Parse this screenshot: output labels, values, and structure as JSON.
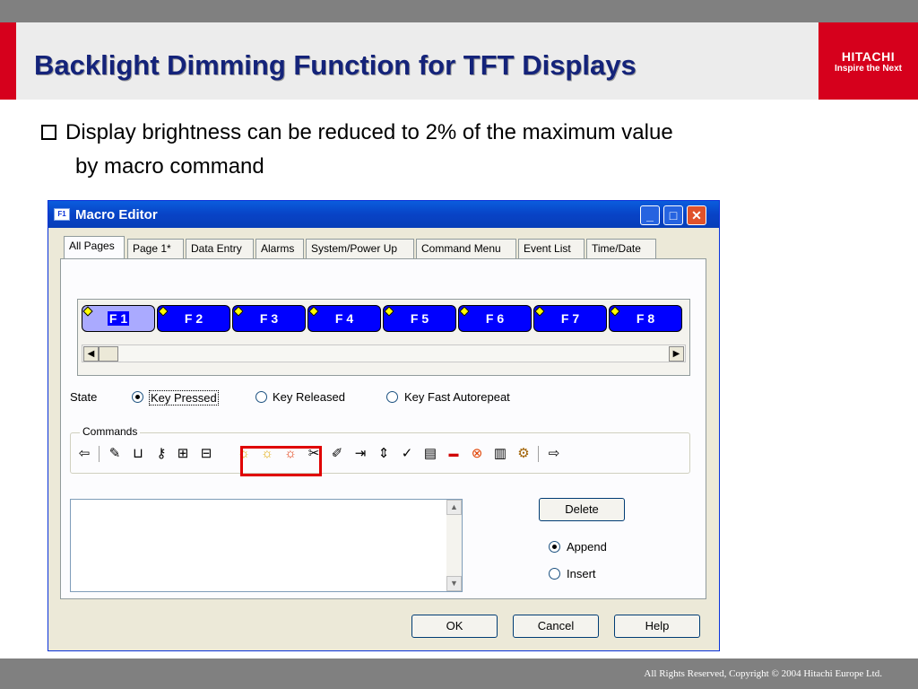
{
  "slide": {
    "title": "Backlight Dimming Function for TFT Displays",
    "logo_name": "HITACHI",
    "logo_tagline": "Inspire the Next",
    "bullet_line1": "Display brightness can be reduced to 2% of the maximum value",
    "bullet_line2": "by macro command",
    "copyright": "All Rights Reserved, Copyright © 2004 Hitachi Europe Ltd.",
    "accent_color": "#d6001c",
    "title_color": "#14237a"
  },
  "window": {
    "title": "Macro Editor",
    "icon_text": "F1",
    "minimize": "_",
    "maximize": "□",
    "close": "✕"
  },
  "tabs": [
    "All Pages",
    "Page 1*",
    "Data Entry",
    "Alarms",
    "System/Power Up",
    "Command Menu",
    "Event List",
    "Time/Date"
  ],
  "keys": {
    "labels": [
      "F 1",
      "F 2",
      "F 3",
      "F 4",
      "F 5",
      "F 6",
      "F 7",
      "F 8"
    ],
    "selected": "F 1",
    "scroll_left": "◀",
    "scroll_right": "▶"
  },
  "state": {
    "label": "State",
    "options": [
      "Key Pressed",
      "Key Released",
      "Key Fast Autorepeat"
    ],
    "selected": "Key Pressed"
  },
  "commands": {
    "legend": "Commands",
    "icons": [
      "arrow-left-icon",
      "pen-icon",
      "bin-icon",
      "key-icon",
      "box-right-icon",
      "box-left-icon",
      "brightness-up-icon",
      "brightness-down-icon",
      "brightness-off-icon",
      "cut-icon",
      "pencil-icon",
      "insert-icon",
      "move-icon",
      "check-icon",
      "page-icon",
      "port-icon",
      "stop-icon",
      "trash-icon",
      "settings-icon",
      "arrow-right-icon"
    ]
  },
  "list": {
    "scroll_up": "▲",
    "scroll_down": "▼"
  },
  "actions": {
    "delete": "Delete",
    "append": "Append",
    "insert": "Insert",
    "insert_mode": "Append",
    "ok": "OK",
    "cancel": "Cancel",
    "help": "Help"
  }
}
